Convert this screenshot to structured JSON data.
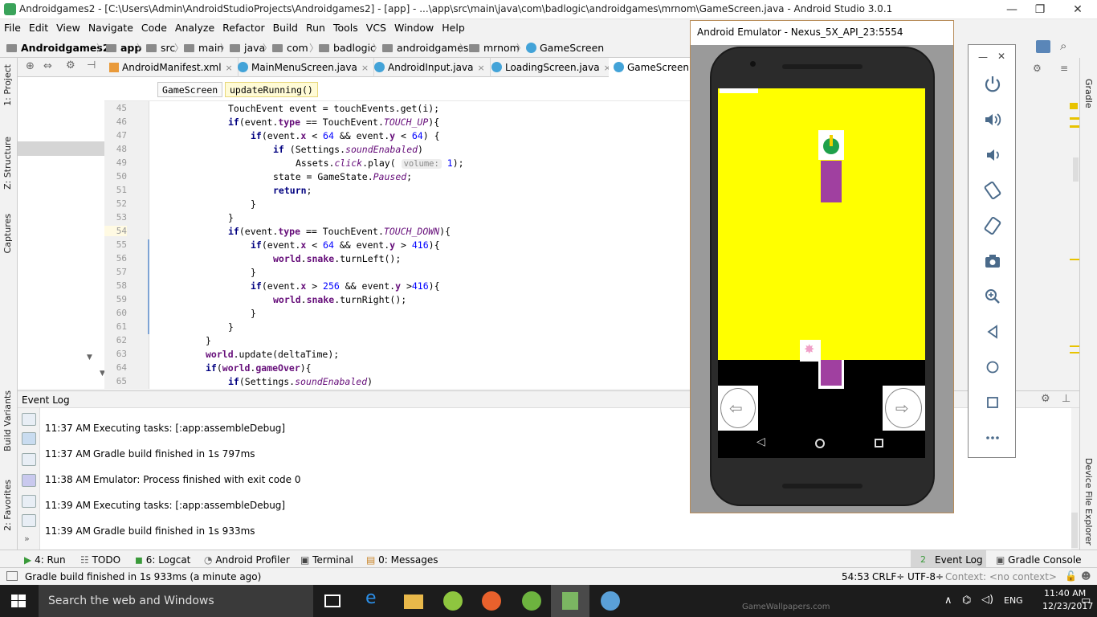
{
  "window": {
    "title": "Androidgames2 - [C:\\Users\\Admin\\AndroidStudioProjects\\Androidgames2] - [app] - ...\\app\\src\\main\\java\\com\\badlogic\\androidgames\\mrnom\\GameScreen.java - Android Studio 3.0.1",
    "minimize": "—",
    "maximize": "❐",
    "close": "✕"
  },
  "menu": [
    "File",
    "Edit",
    "View",
    "Navigate",
    "Code",
    "Analyze",
    "Refactor",
    "Build",
    "Run",
    "Tools",
    "VCS",
    "Window",
    "Help"
  ],
  "breadcrumb": [
    "Androidgames2",
    "app",
    "src",
    "main",
    "java",
    "com",
    "badlogic",
    "androidgames",
    "mrnom",
    "GameScreen"
  ],
  "tabs": [
    "AndroidManifest.xml",
    "MainMenuScreen.java",
    "AndroidInput.java",
    "LoadingScreen.java",
    "GameScreen.ja"
  ],
  "structure": {
    "class_chip": "GameScreen",
    "method_chip": "updateRunning()"
  },
  "left_tools": {
    "project": "1: Project",
    "structure": "Z: Structure",
    "captures": "Captures",
    "build_variants": "Build Variants",
    "favorites": "2: Favorites"
  },
  "right_tools": {
    "gradle": "Gradle",
    "device_file_explorer": "Device File Explorer"
  },
  "code": {
    "line_numbers": [
      "45",
      "46",
      "47",
      "48",
      "49",
      "50",
      "51",
      "52",
      "53",
      "54",
      "55",
      "56",
      "57",
      "58",
      "59",
      "60",
      "61",
      "62",
      "63",
      "64",
      "65"
    ],
    "lines": {
      "l45_a": "TouchEvent event = touchEvents.get(i);",
      "l46_if": "if",
      "l46_a": "(event.",
      "l46_type": "type",
      "l46_b": " == TouchEvent.",
      "l46_const": "TOUCH_UP",
      "l46_c": "){",
      "l47_if": "if",
      "l47_a": "(event.",
      "l47_x": "x",
      "l47_b": " < ",
      "l47_n1": "64",
      "l47_c": " && event.",
      "l47_y": "y",
      "l47_d": " < ",
      "l47_n2": "64",
      "l47_e": ") {",
      "l48_if": "if",
      "l48_a": " (Settings.",
      "l48_f": "soundEnabaled",
      "l48_b": ")",
      "l49_a": "Assets.",
      "l49_f": "click",
      "l49_b": ".play( ",
      "l49_hint": "volume:",
      "l49_n": "1",
      "l49_c": ");",
      "l50_a": "state = GameState.",
      "l50_f": "Paused",
      "l50_b": ";",
      "l51_kw": "return",
      "l51_b": ";",
      "l52": "}",
      "l53": "}",
      "l54_if": "if",
      "l54_a": "(event.",
      "l54_type": "type",
      "l54_b": " == TouchEvent.",
      "l54_const": "TOUCH_DOWN",
      "l54_c": "){",
      "l55_if": "if",
      "l55_a": "(event.",
      "l55_x": "x",
      "l55_b": " < ",
      "l55_n1": "64",
      "l55_c": " && event.",
      "l55_y": "y",
      "l55_d": " > ",
      "l55_n2": "416",
      "l55_e": "){",
      "l56_w": "world",
      "l56_a": ".",
      "l56_s": "snake",
      "l56_b": ".turnLeft();",
      "l57": "}",
      "l58_if": "if",
      "l58_a": "(event.",
      "l58_x": "x",
      "l58_b": " > ",
      "l58_n1": "256",
      "l58_c": " && event.",
      "l58_y": "y",
      "l58_d": " >",
      "l58_n2": "416",
      "l58_e": "){",
      "l59_w": "world",
      "l59_a": ".",
      "l59_s": "snake",
      "l59_b": ".turnRight();",
      "l60": "}",
      "l61": "}",
      "l62": "}",
      "l63_w": "world",
      "l63_b": ".update(deltaTime);",
      "l64_if": "if",
      "l64_a": "(",
      "l64_w": "world",
      "l64_b": ".",
      "l64_g": "gameOver",
      "l64_c": "){",
      "l65_if": "if",
      "l65_a": "(Settings.",
      "l65_f": "soundEnabaled",
      "l65_b": ")"
    }
  },
  "event_log": {
    "title": "Event Log",
    "entries": [
      {
        "time": "11:37 AM",
        "text": "Executing tasks: [:app:assembleDebug]"
      },
      {
        "time": "11:37 AM",
        "text": "Gradle build finished in 1s 797ms"
      },
      {
        "time": "11:38 AM",
        "text": "Emulator: Process finished with exit code 0"
      },
      {
        "time": "11:39 AM",
        "text": "Executing tasks: [:app:assembleDebug]"
      },
      {
        "time": "11:39 AM",
        "text": "Gradle build finished in 1s 933ms"
      }
    ]
  },
  "bottom_tabs": {
    "run": "4: Run",
    "todo": "TODO",
    "logcat": "6: Logcat",
    "profiler": "Android Profiler",
    "terminal": "Terminal",
    "messages": "0: Messages",
    "event_log": "Event Log",
    "event_log_badge": "2",
    "gradle_console": "Gradle Console"
  },
  "status": {
    "message": "Gradle build finished in 1s 933ms (a minute ago)",
    "position": "54:53",
    "line_sep": "CRLF÷",
    "encoding": "UTF-8÷",
    "context": "Context: <no context>"
  },
  "emulator": {
    "title": "Android Emulator - Nexus_5X_API_23:5554",
    "close": "✕",
    "minimize": "—"
  },
  "taskbar": {
    "search": "Search the web and Windows",
    "time": "11:40 AM",
    "date": "12/23/2017",
    "watermark": "GameWallpapers.com",
    "lang": "ENG"
  },
  "colors": {
    "game_bg": "#ffff00",
    "snake": "#a040a0",
    "accent": "#43a3d8"
  }
}
